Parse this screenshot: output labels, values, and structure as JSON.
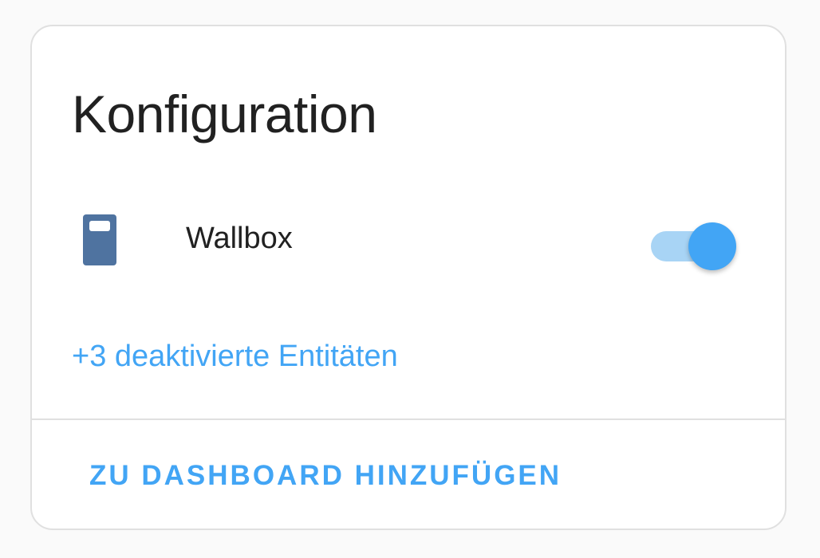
{
  "card": {
    "title": "Konfiguration",
    "entities": [
      {
        "name": "Wallbox",
        "icon": "wallbox-icon",
        "toggle_state": "on"
      }
    ],
    "disabled_entities_link": "+3 deaktivierte Entitäten",
    "action_button": "ZU DASHBOARD HINZUFÜGEN"
  },
  "colors": {
    "accent": "#42a5f5",
    "toggle_track": "#a8d4f5",
    "icon": "#4f73a0",
    "text": "#212121",
    "divider": "#e0e0e0"
  }
}
